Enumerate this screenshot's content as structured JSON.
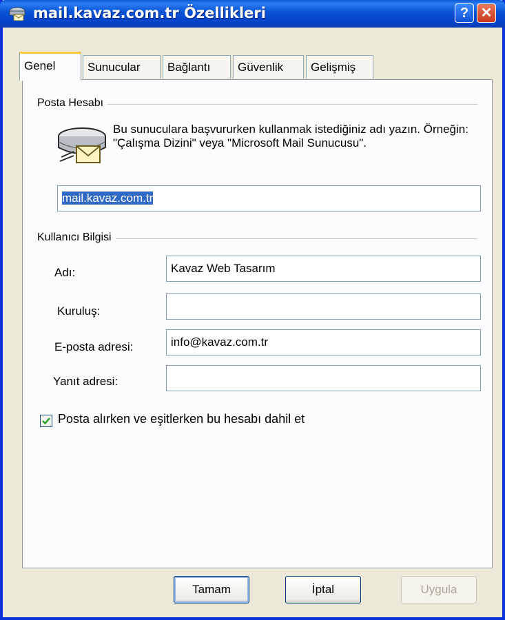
{
  "window": {
    "title": "mail.kavaz.com.tr Özellikleri",
    "help_glyph": "?",
    "close_glyph": "✕"
  },
  "tabs": [
    {
      "label": "Genel",
      "active": true
    },
    {
      "label": "Sunucular",
      "active": false
    },
    {
      "label": "Bağlantı",
      "active": false
    },
    {
      "label": "Güvenlik",
      "active": false
    },
    {
      "label": "Gelişmiş",
      "active": false
    }
  ],
  "posta_hesabi": {
    "group_title": "Posta Hesabı",
    "description": "Bu sunuculara başvururken kullanmak istediğiniz adı yazın.  Örneğin: \"Çalışma Dizini\" veya \"Microsoft Mail Sunucusu\".",
    "account_name_value": "mail.kavaz.com.tr",
    "icon": "mail-server-icon"
  },
  "kullanici_bilgisi": {
    "group_title": "Kullanıcı Bilgisi",
    "fields": [
      {
        "label": "Adı:",
        "value": "Kavaz Web Tasarım"
      },
      {
        "label": "Kuruluş:",
        "value": ""
      },
      {
        "label": "E-posta adresi:",
        "value": "info@kavaz.com.tr"
      },
      {
        "label": "Yanıt adresi:",
        "value": ""
      }
    ]
  },
  "include_checkbox": {
    "label": "Posta alırken ve eşitlerken bu hesabı dahil et",
    "checked": true
  },
  "buttons": {
    "ok": "Tamam",
    "cancel": "İptal",
    "apply": "Uygula"
  },
  "colors": {
    "titlebar": "#0853d6",
    "selection": "#316ac5",
    "active_tab_accent": "#ffc83c",
    "close_button": "#c8391a"
  }
}
